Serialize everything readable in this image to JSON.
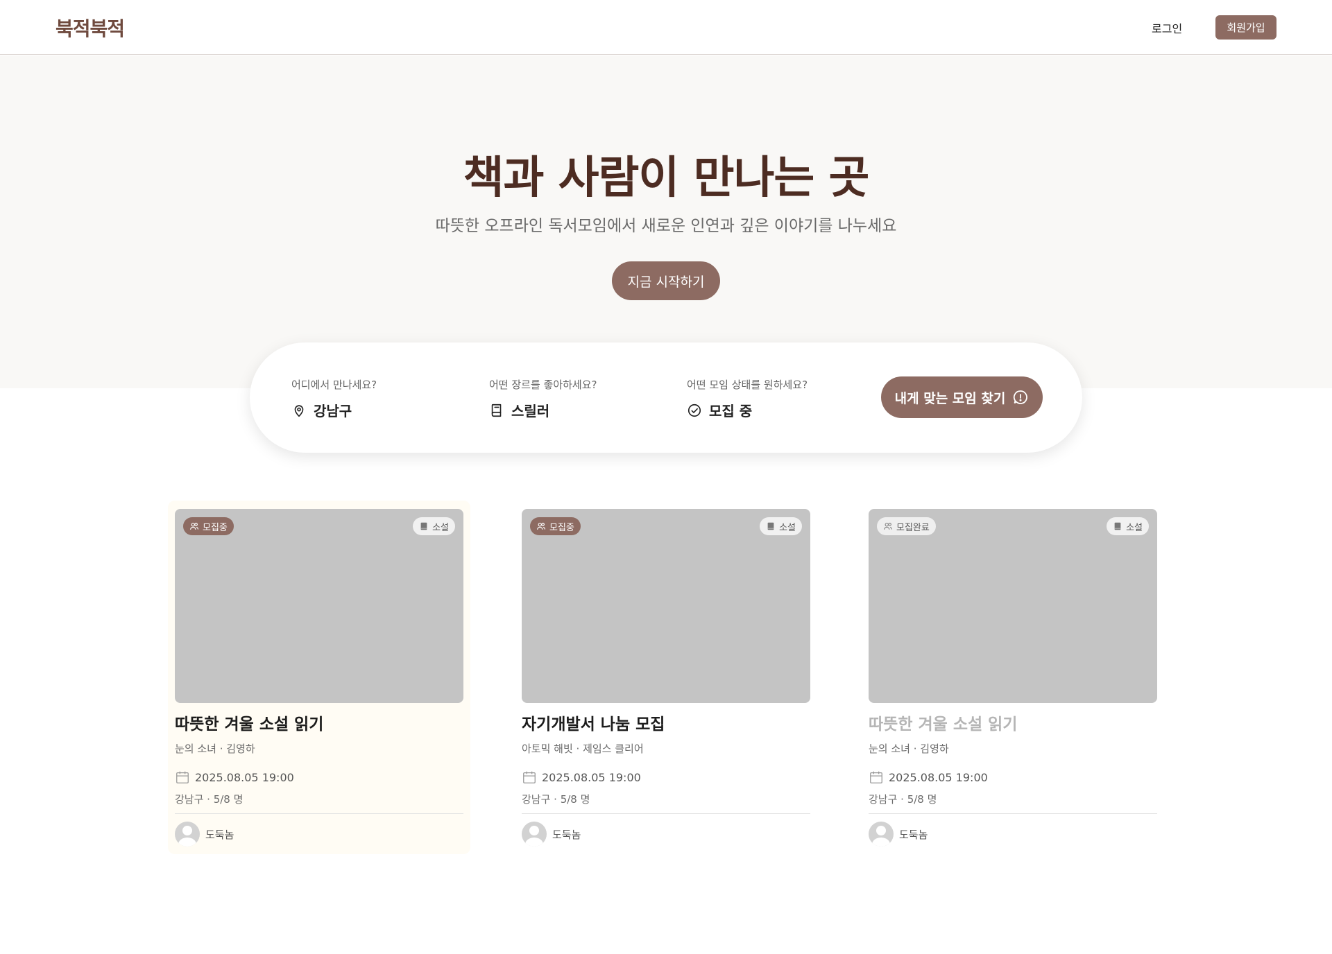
{
  "header": {
    "logo": "북적북적",
    "login_label": "로그인",
    "signup_label": "회원가입"
  },
  "hero": {
    "title": "책과 사람이 만나는 곳",
    "subtitle": "따뜻한 오프라인 독서모임에서 새로운 인연과 깊은 이야기를 나누세요",
    "cta_label": "지금 시작하기"
  },
  "search": {
    "location": {
      "label": "어디에서 만나세요?",
      "value": "강남구",
      "icon": "map-pin-icon"
    },
    "genre": {
      "label": "어떤 장르를 좋아하세요?",
      "value": "스릴러",
      "icon": "book-icon"
    },
    "status": {
      "label": "어떤 모임 상태를 원하세요?",
      "value": "모집 중",
      "icon": "check-circle-icon"
    },
    "submit_label": "내게 맞는 모임 찾기"
  },
  "colors": {
    "brand": "#8d6b62",
    "title": "#4d2c22",
    "hero_bg": "#f9f8f6"
  },
  "cards": [
    {
      "status": "모집중",
      "status_type": "open",
      "genre": "소설",
      "title": "따뜻한 겨울 소설 읽기",
      "book": "눈의 소녀 · 김영하",
      "datetime": "2025.08.05 19:00",
      "location": "강남구 · 5/8 명",
      "host": "도둑놈"
    },
    {
      "status": "모집중",
      "status_type": "open",
      "genre": "소설",
      "title": "자기개발서 나눔 모집",
      "book": "아토믹 해빗 · 제임스 클리어",
      "datetime": "2025.08.05 19:00",
      "location": "강남구 · 5/8 명",
      "host": "도둑놈"
    },
    {
      "status": "모집완료",
      "status_type": "closed",
      "genre": "소설",
      "title": "따뜻한 겨울 소설 읽기",
      "book": "눈의 소녀 · 김영하",
      "datetime": "2025.08.05 19:00",
      "location": "강남구 · 5/8 명",
      "host": "도둑놈"
    }
  ]
}
